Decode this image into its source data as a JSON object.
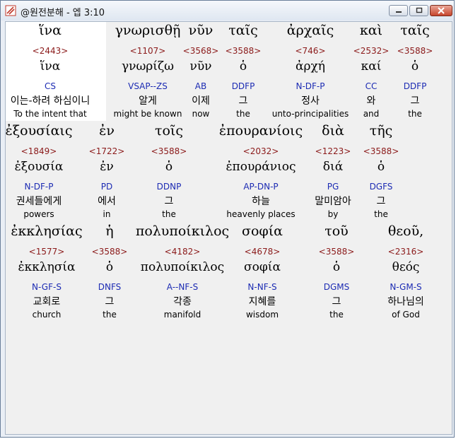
{
  "window": {
    "title": "@원전분해 - 엡 3:10"
  },
  "rows": [
    [
      {
        "greek": "ἵνα",
        "num": "<2443>",
        "lemma": "ἵνα",
        "parse": "CS",
        "korean": "이는-하려 하심이니",
        "english": "To the intent that"
      },
      {
        "greek": "γνωρισθῇ",
        "num": "<1107>",
        "lemma": "γνωρίζω",
        "parse": "VSAP--ZS",
        "korean": "알게",
        "english": "might be known"
      },
      {
        "greek": "νῦν",
        "num": "<3568>",
        "lemma": "νῦν",
        "parse": "AB",
        "korean": "이제",
        "english": "now"
      },
      {
        "greek": "ταῖς",
        "num": "<3588>",
        "lemma": "ὁ",
        "parse": "DDFP",
        "korean": "그",
        "english": "the"
      },
      {
        "greek": "ἀρχαῖς",
        "num": "<746>",
        "lemma": "ἀρχή",
        "parse": "N-DF-P",
        "korean": "정사",
        "english": "unto-principalities"
      },
      {
        "greek": "καὶ",
        "num": "<2532>",
        "lemma": "καί",
        "parse": "CC",
        "korean": "와",
        "english": "and"
      },
      {
        "greek": "ταῖς",
        "num": "<3588>",
        "lemma": "ὁ",
        "parse": "DDFP",
        "korean": "그",
        "english": "the"
      }
    ],
    [
      {
        "greek": "ἐξουσίαις",
        "num": "<1849>",
        "lemma": "ἐξουσία",
        "parse": "N-DF-P",
        "korean": "권세들에게",
        "english": "powers"
      },
      {
        "greek": "ἐν",
        "num": "<1722>",
        "lemma": "ἐν",
        "parse": "PD",
        "korean": "에서",
        "english": "in"
      },
      {
        "greek": "τοῖς",
        "num": "<3588>",
        "lemma": "ὁ",
        "parse": "DDNP",
        "korean": "그",
        "english": "the"
      },
      {
        "greek": "ἐπουρανίοις",
        "num": "<2032>",
        "lemma": "ἐπουράνιος",
        "parse": "AP-DN-P",
        "korean": "하늘",
        "english": "heavenly places"
      },
      {
        "greek": "διὰ",
        "num": "<1223>",
        "lemma": "διά",
        "parse": "PG",
        "korean": "말미암아",
        "english": "by"
      },
      {
        "greek": "τῆς",
        "num": "<3588>",
        "lemma": "ὁ",
        "parse": "DGFS",
        "korean": "그",
        "english": "the"
      }
    ],
    [
      {
        "greek": "ἐκκλησίας",
        "num": "<1577>",
        "lemma": "ἐκκλησία",
        "parse": "N-GF-S",
        "korean": "교회로",
        "english": "church"
      },
      {
        "greek": "ἡ",
        "num": "<3588>",
        "lemma": "ὁ",
        "parse": "DNFS",
        "korean": "그",
        "english": "the"
      },
      {
        "greek": "πολυποίκιλος",
        "num": "<4182>",
        "lemma": "πολυποίκιλος",
        "parse": "A--NF-S",
        "korean": "각종",
        "english": "manifold"
      },
      {
        "greek": "σοφία",
        "num": "<4678>",
        "lemma": "σοφία",
        "parse": "N-NF-S",
        "korean": "지혜를",
        "english": "wisdom"
      },
      {
        "greek": "τοῦ",
        "num": "<3588>",
        "lemma": "ὁ",
        "parse": "DGMS",
        "korean": "그",
        "english": "the"
      },
      {
        "greek": "θεοῦ,",
        "num": "<2316>",
        "lemma": "θεός",
        "parse": "N-GM-S",
        "korean": "하나님의",
        "english": "of God"
      }
    ]
  ]
}
